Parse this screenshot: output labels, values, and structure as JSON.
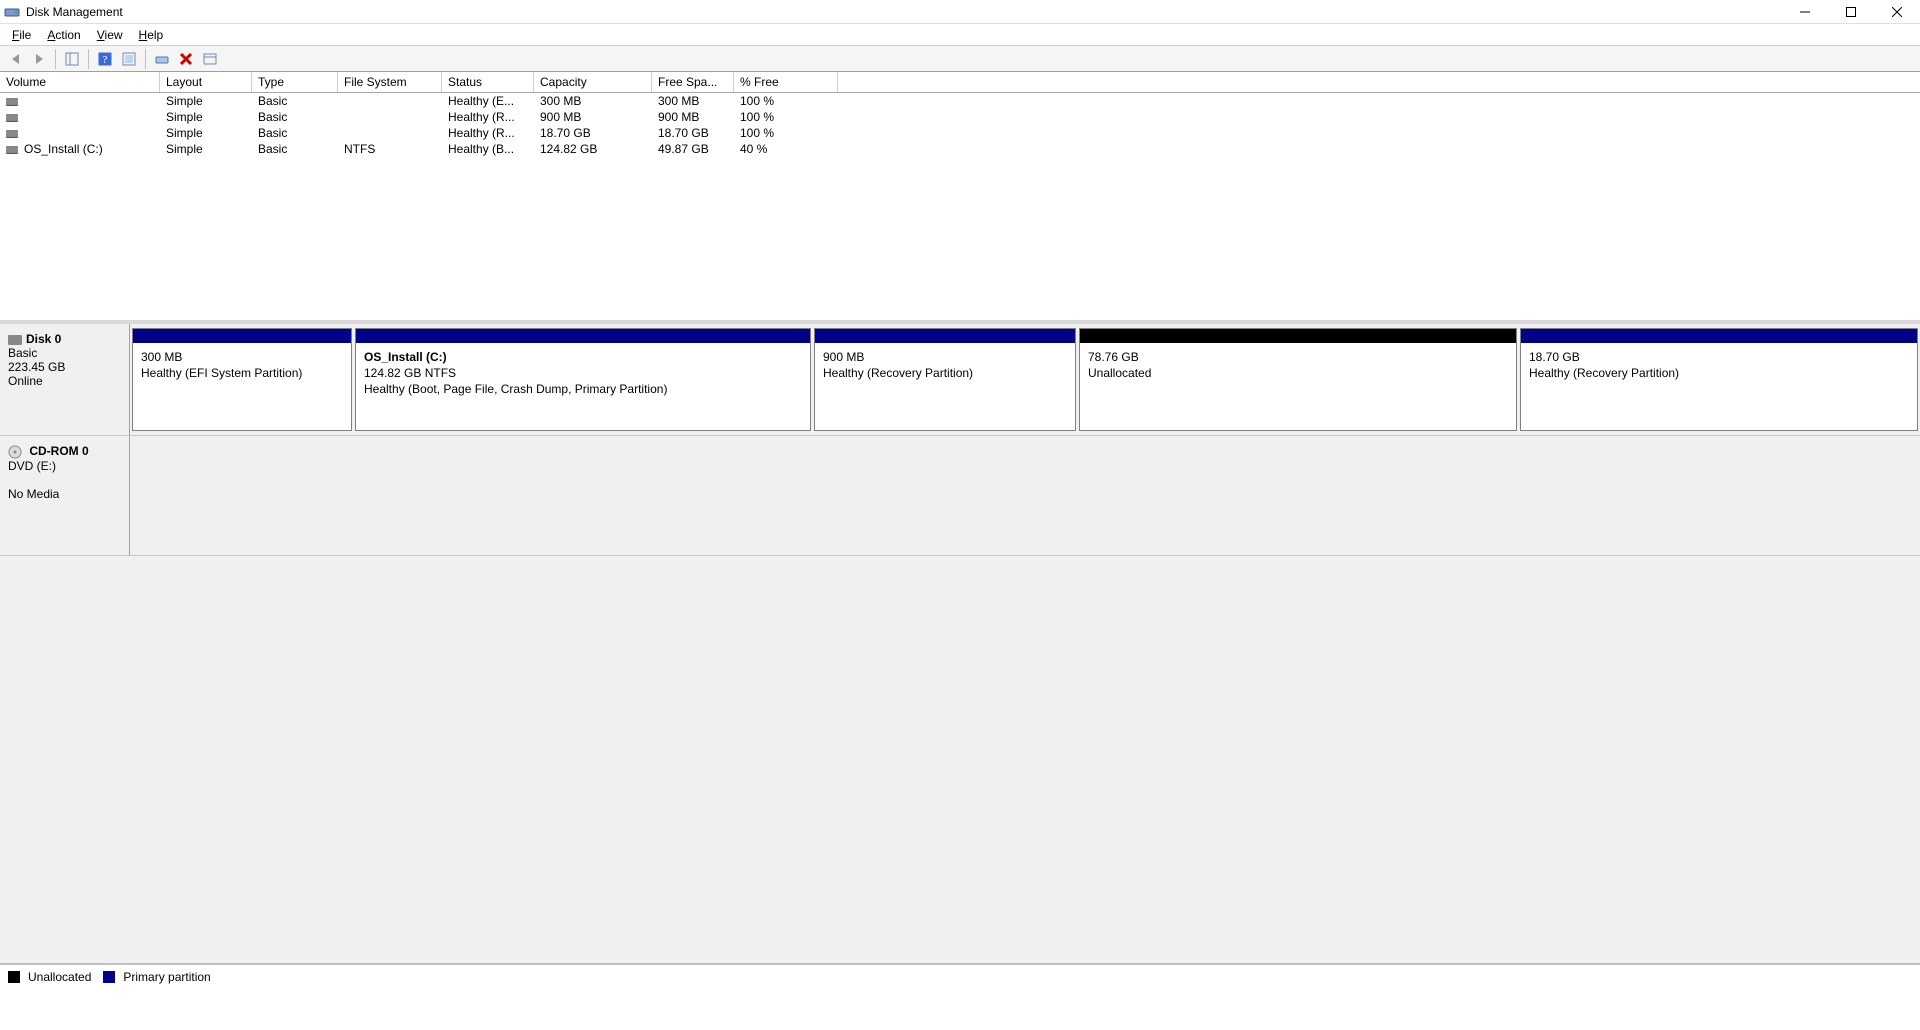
{
  "window": {
    "title": "Disk Management"
  },
  "menu": {
    "file": "File",
    "action": "Action",
    "view": "View",
    "help": "Help"
  },
  "columns": {
    "volume": "Volume",
    "layout": "Layout",
    "type": "Type",
    "fs": "File System",
    "status": "Status",
    "capacity": "Capacity",
    "free": "Free Spa...",
    "percent": "% Free"
  },
  "volumes": [
    {
      "name": "",
      "layout": "Simple",
      "type": "Basic",
      "fs": "",
      "status": "Healthy (E...",
      "capacity": "300 MB",
      "free": "300 MB",
      "percent": "100 %"
    },
    {
      "name": "",
      "layout": "Simple",
      "type": "Basic",
      "fs": "",
      "status": "Healthy (R...",
      "capacity": "900 MB",
      "free": "900 MB",
      "percent": "100 %"
    },
    {
      "name": "",
      "layout": "Simple",
      "type": "Basic",
      "fs": "",
      "status": "Healthy (R...",
      "capacity": "18.70 GB",
      "free": "18.70 GB",
      "percent": "100 %"
    },
    {
      "name": "OS_Install (C:)",
      "layout": "Simple",
      "type": "Basic",
      "fs": "NTFS",
      "status": "Healthy (B...",
      "capacity": "124.82 GB",
      "free": "49.87 GB",
      "percent": "40 %"
    }
  ],
  "disks": [
    {
      "name": "Disk 0",
      "type": "Basic",
      "size": "223.45 GB",
      "status": "Online",
      "partitions": [
        {
          "title": "",
          "line2": "300 MB",
          "line3": "Healthy (EFI System Partition)",
          "kind": "primary"
        },
        {
          "title": "OS_Install  (C:)",
          "line2": "124.82 GB NTFS",
          "line3": "Healthy (Boot, Page File, Crash Dump, Primary Partition)",
          "kind": "primary"
        },
        {
          "title": "",
          "line2": "900 MB",
          "line3": "Healthy (Recovery Partition)",
          "kind": "primary"
        },
        {
          "title": "",
          "line2": "78.76 GB",
          "line3": "Unallocated",
          "kind": "unalloc"
        },
        {
          "title": "",
          "line2": "18.70 GB",
          "line3": "Healthy (Recovery Partition)",
          "kind": "primary"
        }
      ]
    }
  ],
  "cdrom": {
    "name": "CD-ROM 0",
    "drive": "DVD (E:)",
    "status": "No Media"
  },
  "legend": {
    "unallocated": "Unallocated",
    "primary": "Primary partition"
  }
}
